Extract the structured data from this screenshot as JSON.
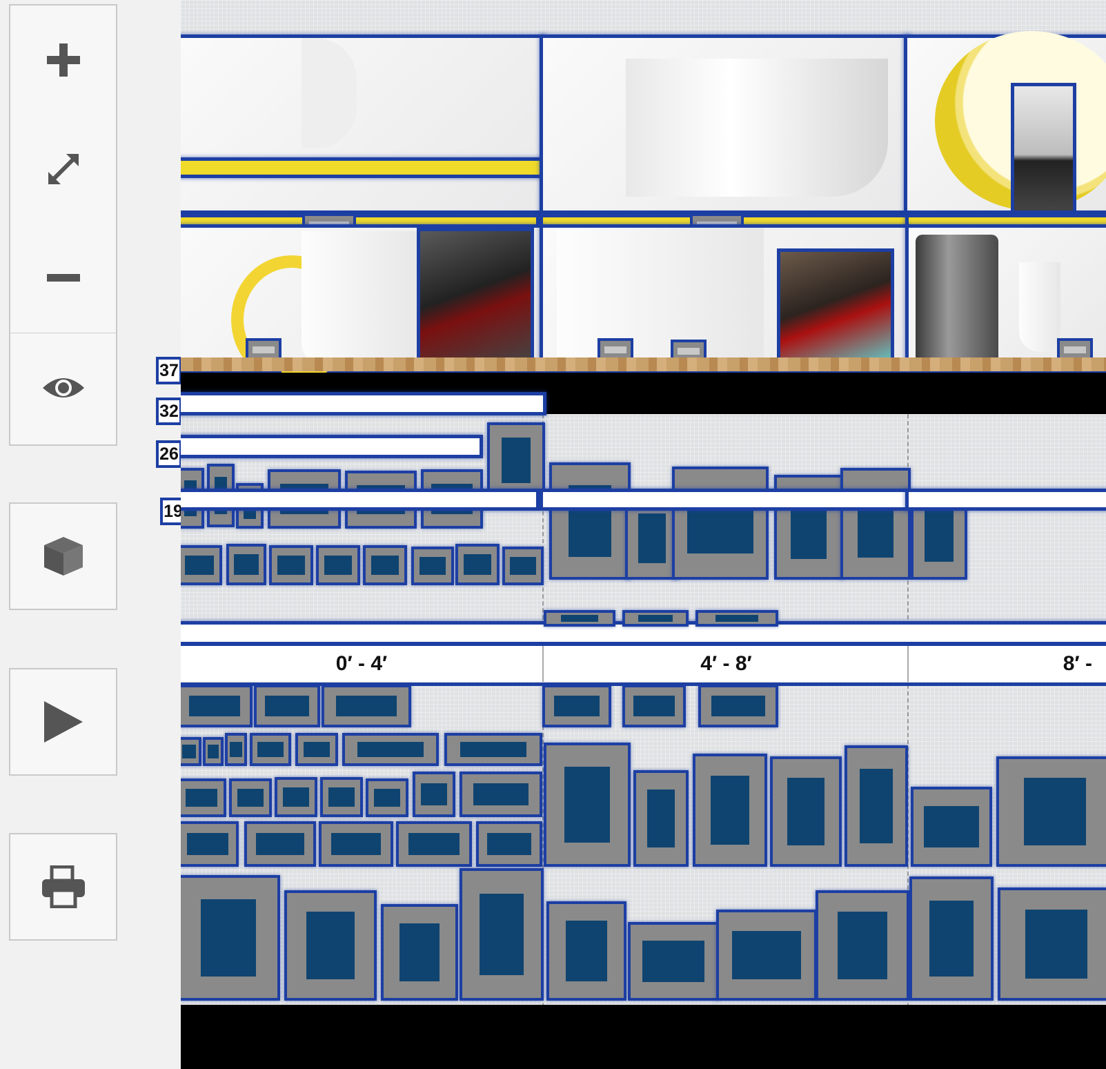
{
  "toolbar": {
    "zoom_in_icon": "plus-icon",
    "fit_icon": "expand-arrows-icon",
    "zoom_out_icon": "minus-icon",
    "view_icon": "eye-icon",
    "three_d_icon": "cube-icon",
    "play_icon": "play-icon",
    "print_icon": "printer-icon"
  },
  "shelves": {
    "labels": [
      "37",
      "32",
      "26",
      "19"
    ]
  },
  "ruler": {
    "sections": [
      "0′ - 4′",
      "4′ - 8′",
      "8′ -"
    ]
  },
  "colors": {
    "selection": "#1d3fa3",
    "product_fill": "#8a8a8a",
    "product_inner": "#0f4470",
    "accent_yellow": "#f0da2a",
    "floor": "#000000"
  }
}
